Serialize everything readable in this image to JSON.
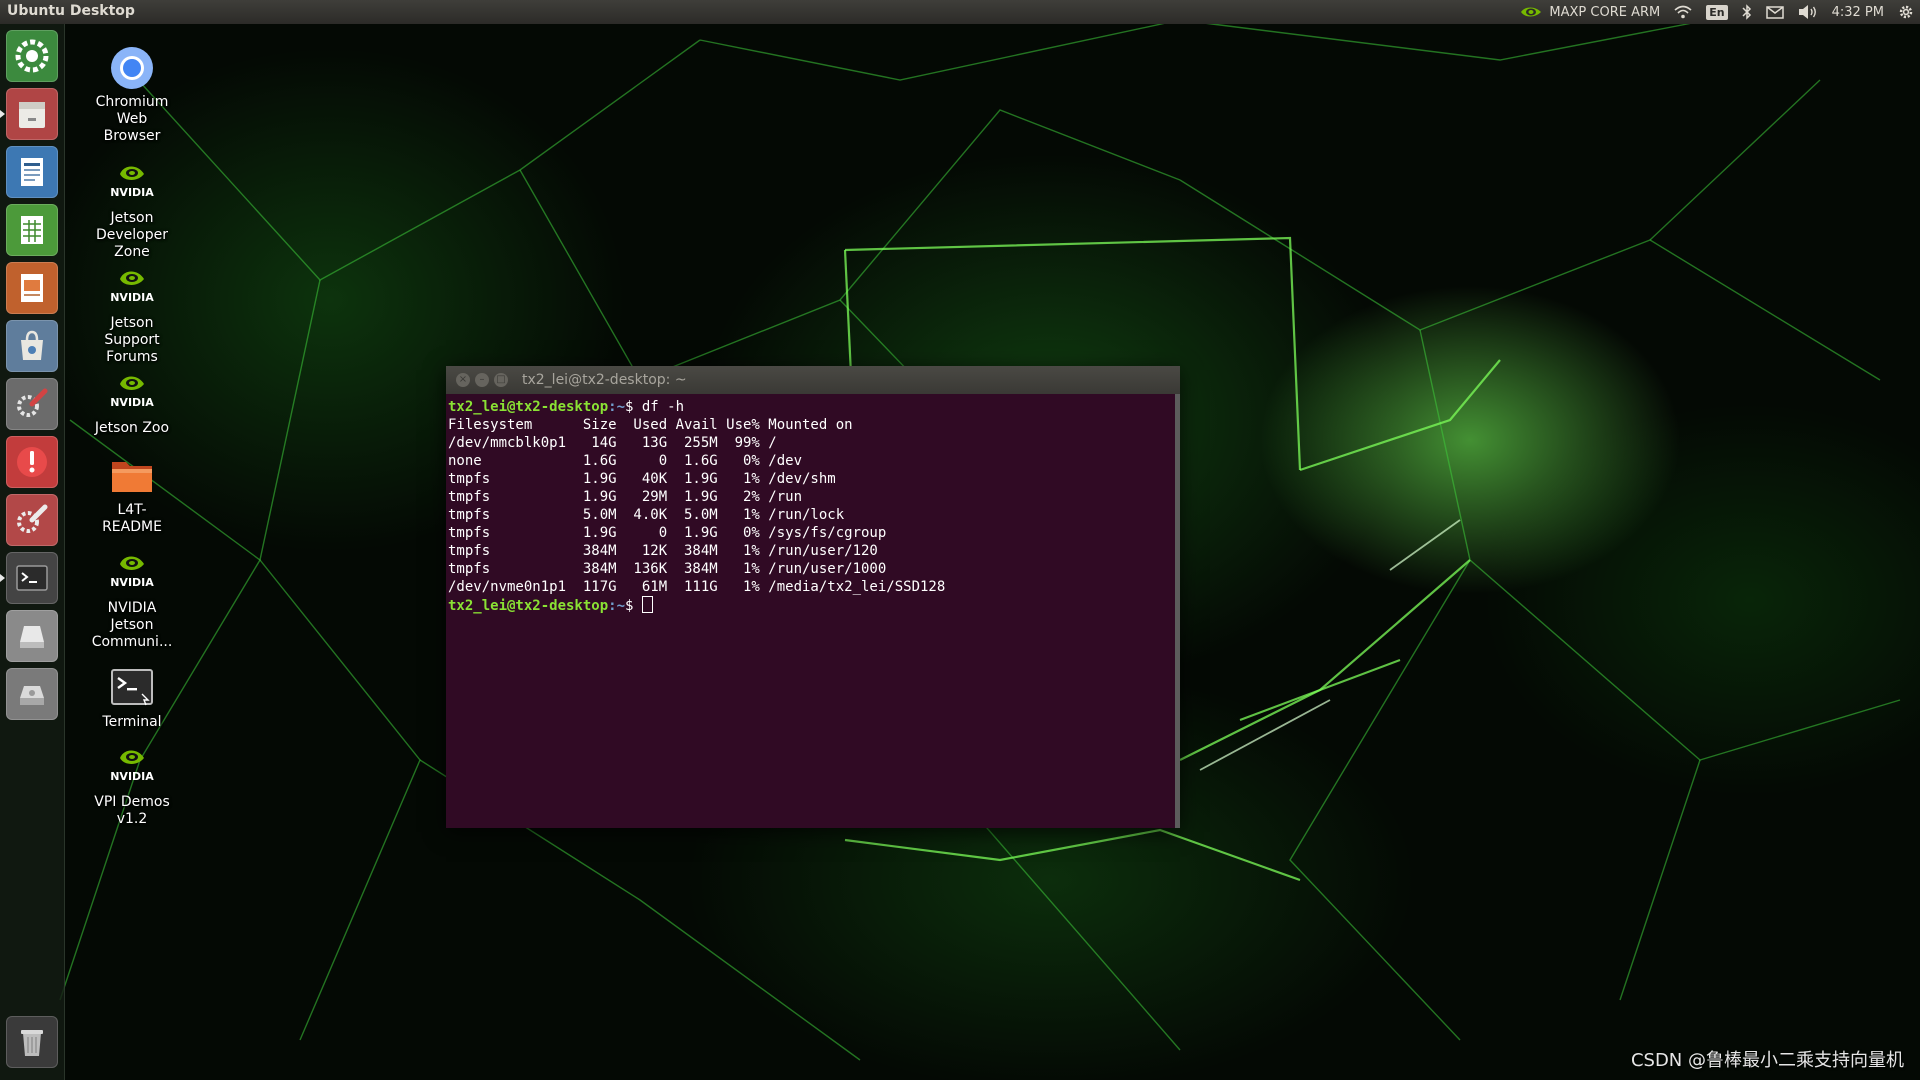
{
  "top_panel": {
    "title": "Ubuntu Desktop",
    "power_mode": "MAXP CORE ARM",
    "keyboard_layout": "En",
    "time": "4:32 PM",
    "icons": [
      "nvidia-icon",
      "wifi-icon",
      "bluetooth-icon",
      "mail-icon",
      "volume-icon",
      "gear-icon"
    ]
  },
  "launcher": {
    "items": [
      {
        "name": "launcher-system-settings",
        "icon": "settings-circle-icon"
      },
      {
        "name": "launcher-files",
        "icon": "file-cabinet-icon"
      },
      {
        "name": "launcher-writer",
        "icon": "document-icon"
      },
      {
        "name": "launcher-calc",
        "icon": "spreadsheet-icon"
      },
      {
        "name": "launcher-impress",
        "icon": "presentation-icon"
      },
      {
        "name": "launcher-software",
        "icon": "shopping-bag-icon"
      },
      {
        "name": "launcher-settings-tools",
        "icon": "tools-icon"
      },
      {
        "name": "launcher-error-report",
        "icon": "warning-icon"
      },
      {
        "name": "launcher-tools",
        "icon": "tools-icon"
      },
      {
        "name": "launcher-terminal",
        "icon": "terminal-icon"
      },
      {
        "name": "launcher-drive",
        "icon": "drive-icon"
      },
      {
        "name": "launcher-disk",
        "icon": "disk-icon"
      },
      {
        "name": "launcher-trash",
        "icon": "trash-icon"
      }
    ]
  },
  "desktop_icons": [
    {
      "label": "Chromium\nWeb\nBrowser",
      "icon": "chromium-icon"
    },
    {
      "label": "Jetson\nDeveloper\nZone",
      "icon": "nvidia-icon"
    },
    {
      "label": "Jetson\nSupport\nForums",
      "icon": "nvidia-icon"
    },
    {
      "label": "Jetson Zoo",
      "icon": "nvidia-icon"
    },
    {
      "label": "L4T-\nREADME",
      "icon": "folder-icon"
    },
    {
      "label": "NVIDIA\nJetson\nCommuni...",
      "icon": "nvidia-icon"
    },
    {
      "label": "Terminal",
      "icon": "terminal-icon"
    },
    {
      "label": "VPI Demos\nv1.2",
      "icon": "nvidia-icon"
    }
  ],
  "nvidia_logo_text": "NVIDIA",
  "terminal": {
    "title": "tx2_lei@tx2-desktop: ~",
    "prompt_user": "tx2_lei@tx2-desktop",
    "prompt_path": ":~",
    "prompt_symbol": "$ ",
    "command": "df -h",
    "output_lines": [
      "Filesystem      Size  Used Avail Use% Mounted on",
      "/dev/mmcblk0p1   14G   13G  255M  99% /",
      "none            1.6G     0  1.6G   0% /dev",
      "tmpfs           1.9G   40K  1.9G   1% /dev/shm",
      "tmpfs           1.9G   29M  1.9G   2% /run",
      "tmpfs           5.0M  4.0K  5.0M   1% /run/lock",
      "tmpfs           1.9G     0  1.9G   0% /sys/fs/cgroup",
      "tmpfs           384M   12K  384M   1% /run/user/120",
      "tmpfs           384M  136K  384M   1% /run/user/1000",
      "/dev/nvme0n1p1  117G   61M  111G   1% /media/tx2_lei/SSD128"
    ]
  },
  "watermark": "CSDN @鲁棒最小二乘支持向量机"
}
